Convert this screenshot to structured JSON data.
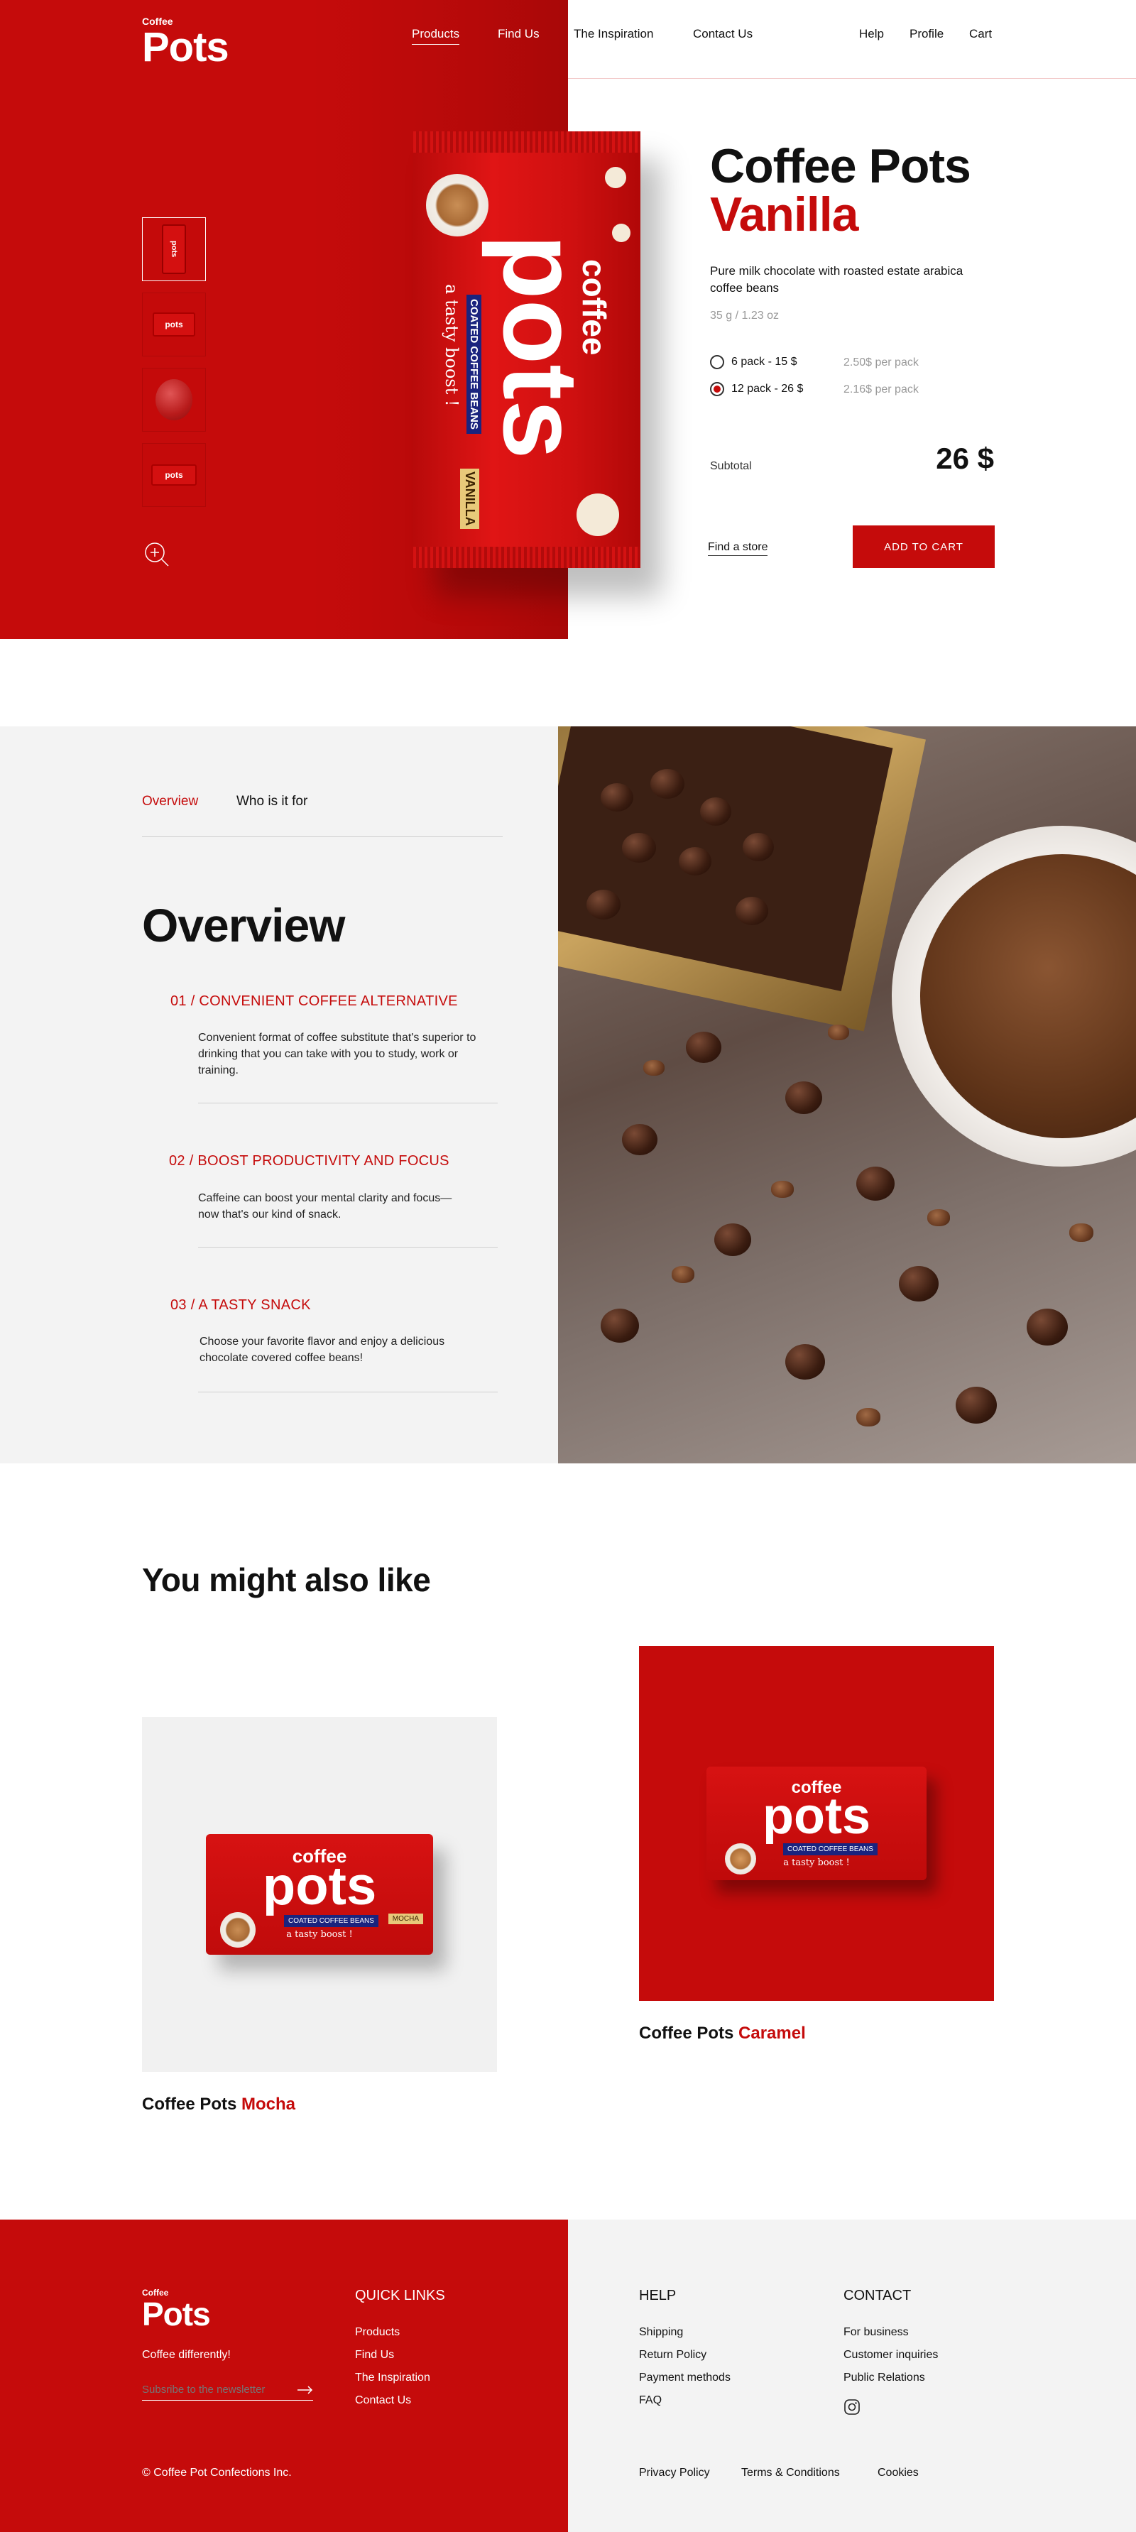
{
  "brand": {
    "small": "Coffee",
    "big": "Pots"
  },
  "nav": {
    "left": [
      "Products",
      "Find Us",
      "The Inspiration",
      "Contact Us"
    ],
    "right": [
      "Help",
      "Profile",
      "Cart"
    ]
  },
  "product": {
    "title_line1": "Coffee Pots",
    "title_line2": "Vanilla",
    "description": "Pure milk chocolate with roasted estate arabica coffee beans",
    "weight": "35 g / 1.23 oz",
    "options": [
      {
        "label": "6 pack - 15 $",
        "per": "2.50$ per pack",
        "selected": false
      },
      {
        "label": "12 pack - 26 $",
        "per": "2.16$  per pack",
        "selected": true
      }
    ],
    "subtotal_label": "Subtotal",
    "subtotal_value": "26 $",
    "find_store": "Find a store",
    "add_to_cart": "ADD TO CART",
    "pack_text": {
      "coffee": "coffee",
      "pots": "pots",
      "coated": "COATED COFFEE BEANS",
      "tasty": "a tasty boost !",
      "flavor": "VANILLA",
      "thumb": "pots"
    }
  },
  "overview": {
    "tabs": [
      "Overview",
      "Who is it for"
    ],
    "heading": "Overview",
    "items": [
      {
        "num": "01 / ",
        "title": "CONVENIENT COFFEE ALTERNATIVE",
        "text": "Convenient format of coffee substitute that's superior to drinking that you can take with you to study, work or training."
      },
      {
        "num": "02 / ",
        "title": "BOOST PRODUCTIVITY AND FOCUS",
        "text": "Caffeine can boost your mental clarity and focus—now that's our kind of snack."
      },
      {
        "num": "03 / ",
        "title": "A TASTY SNACK",
        "text": "Choose your favorite flavor and enjoy a delicious chocolate covered coffee beans!"
      }
    ]
  },
  "related": {
    "heading": "You might also like",
    "cards": [
      {
        "name": "Coffee Pots ",
        "flavor": "Mocha",
        "pack_coffee": "coffee",
        "pack_pots": "pots",
        "pack_coated": "COATED COFFEE BEANS",
        "pack_tasty": "a tasty boost !",
        "pack_flavor": "MOCHA"
      },
      {
        "name": "Coffee Pots ",
        "flavor": "Caramel",
        "pack_coffee": "coffee",
        "pack_pots": "pots",
        "pack_coated": "COATED COFFEE BEANS",
        "pack_tasty": "a tasty boost !"
      }
    ]
  },
  "footer": {
    "tagline": "Coffee differently!",
    "newsletter_placeholder": "Subsribe to the newsletter",
    "quick_links_title": "QUICK LINKS",
    "quick_links": [
      "Products",
      "Find Us",
      "The Inspiration",
      "Contact Us"
    ],
    "help_title": "HELP",
    "help_links": [
      "Shipping",
      "Return Policy",
      "Payment methods",
      "FAQ"
    ],
    "contact_title": "CONTACT",
    "contact_links": [
      "For business",
      "Customer inquiries",
      "Public Relations"
    ],
    "copyright": "© Coffee Pot Confections Inc.",
    "legal": [
      "Privacy Policy",
      "Terms & Conditions",
      "Cookies"
    ]
  },
  "colors": {
    "accent": "#c50b0b",
    "light_gray": "#f3f3f3"
  },
  "icons": {
    "zoom": "zoom-in-icon",
    "arrow": "arrow-right-icon",
    "instagram": "instagram-icon"
  }
}
